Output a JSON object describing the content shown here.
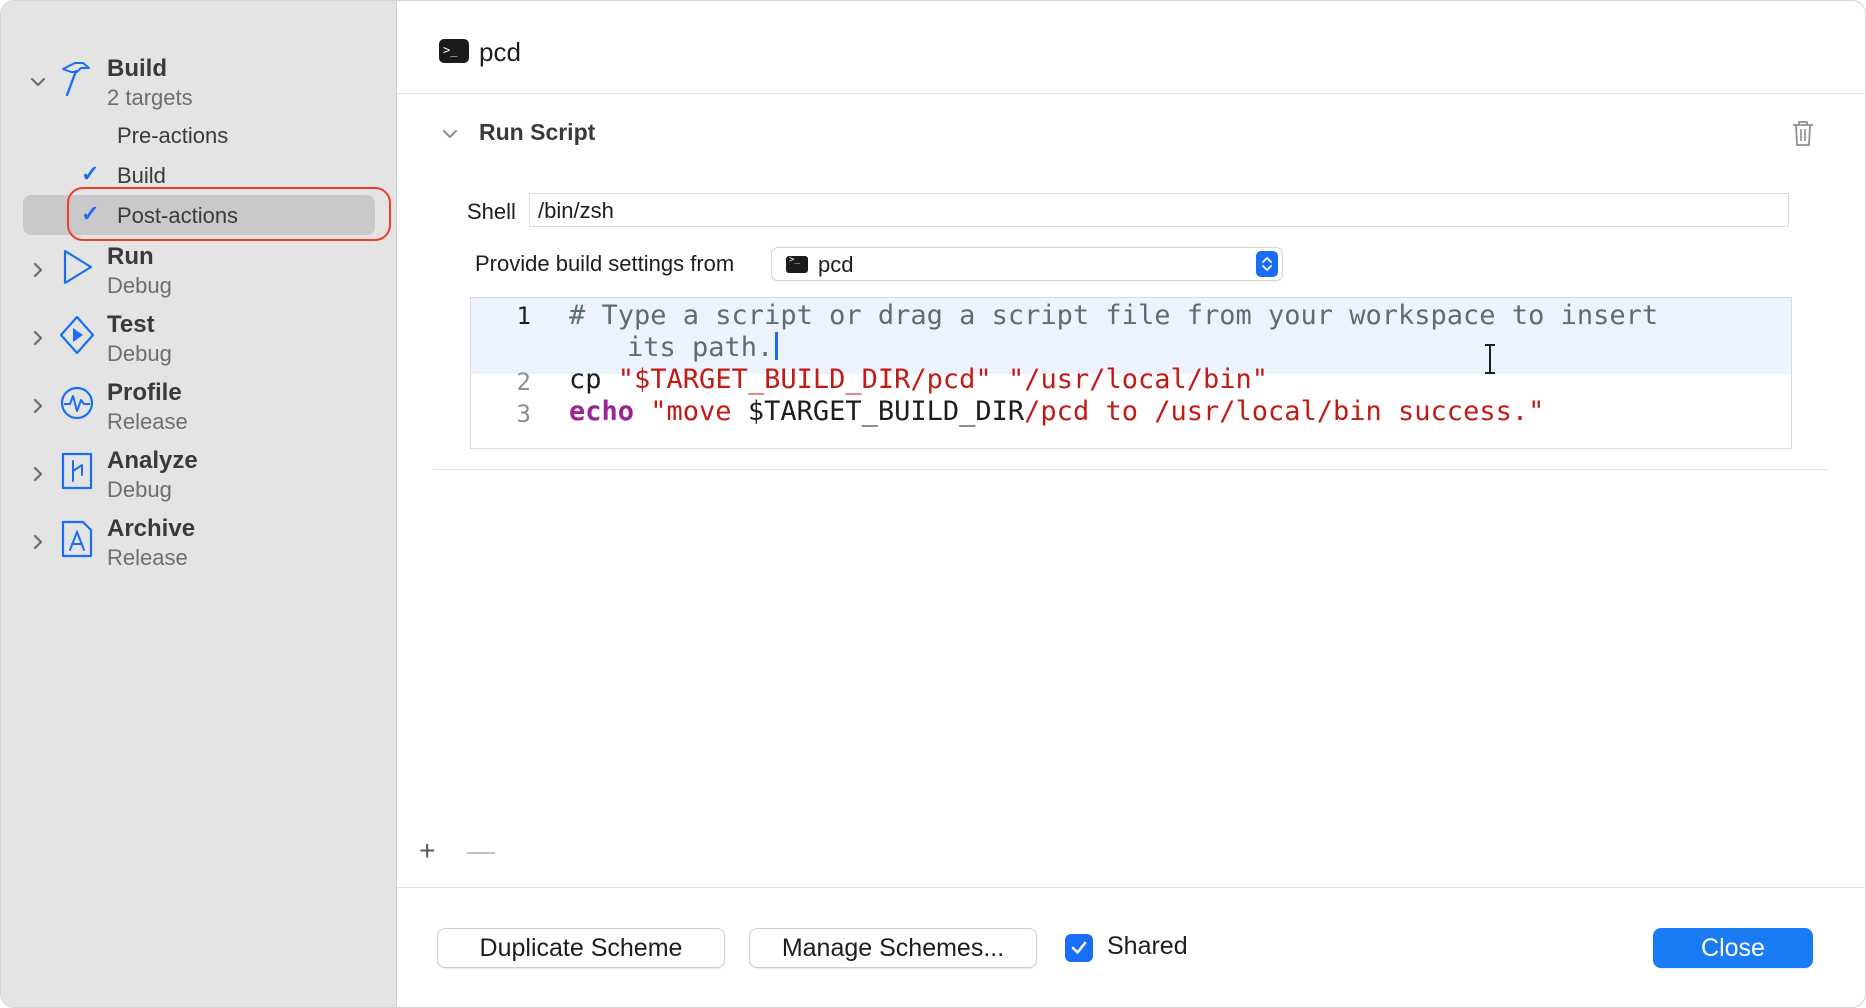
{
  "sidebar": {
    "build": {
      "title": "Build",
      "subtitle": "2 targets"
    },
    "build_children": [
      {
        "label": "Pre-actions",
        "checked": false
      },
      {
        "label": "Build",
        "checked": true
      },
      {
        "label": "Post-actions",
        "checked": true,
        "selected": true
      }
    ],
    "groups": [
      {
        "title": "Run",
        "subtitle": "Debug",
        "icon": "play-icon"
      },
      {
        "title": "Test",
        "subtitle": "Debug",
        "icon": "test-diamond-icon"
      },
      {
        "title": "Profile",
        "subtitle": "Release",
        "icon": "profile-gauge-icon"
      },
      {
        "title": "Analyze",
        "subtitle": "Debug",
        "icon": "analyze-icon"
      },
      {
        "title": "Archive",
        "subtitle": "Release",
        "icon": "archive-icon"
      }
    ]
  },
  "header": {
    "title": "pcd",
    "icon": "terminal-icon"
  },
  "run_script": {
    "title": "Run Script",
    "shell_label": "Shell",
    "shell_value": "/bin/zsh",
    "build_settings_label": "Provide build settings from",
    "build_settings_value": "pcd",
    "code": {
      "line_numbers": [
        "1",
        "2",
        "3"
      ],
      "line1_part1": "# Type a script or drag a script file from your workspace to insert",
      "line1_part2": "its path.",
      "line2_cmd": "cp ",
      "line2_str1": "\"$TARGET_BUILD_DIR",
      "line2_str1b": "/pcd\" ",
      "line2_str2": "\"/usr/local/bin\"",
      "line3_kw": "echo",
      "line3_str_a": " \"move ",
      "line3_var": "$TARGET_BUILD_DIR",
      "line3_str_b": "/pcd to /usr/local/bin success.\""
    }
  },
  "actions": {
    "add": "+",
    "remove": "—"
  },
  "footer": {
    "duplicate_label": "Duplicate Scheme",
    "manage_label": "Manage Schemes...",
    "shared_label": "Shared",
    "shared_checked": true,
    "close_label": "Close"
  },
  "colors": {
    "accent": "#1a6ef5",
    "highlight_ring": "#e8402b",
    "string": "#c41a16",
    "keyword": "#9b2393"
  }
}
